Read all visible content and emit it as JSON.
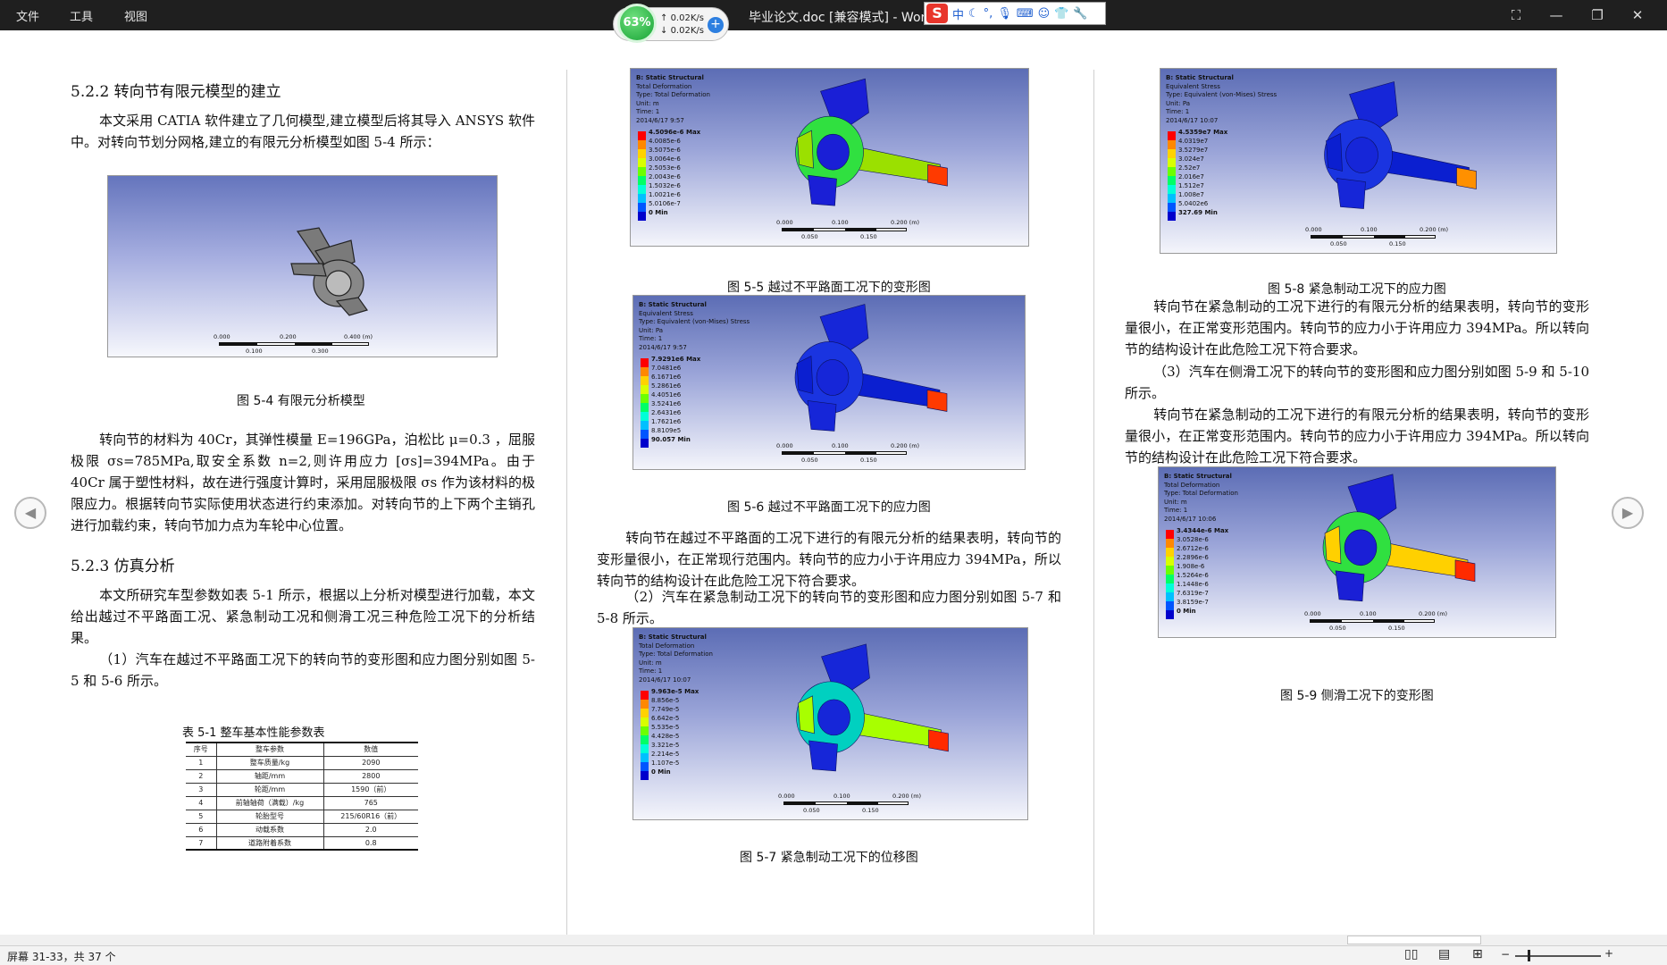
{
  "titlebar": {
    "menu": [
      "文件",
      "工具",
      "视图"
    ],
    "title": "毕业论文.doc [兼容模式] - Word",
    "net_percent": "63%",
    "up_speed": "0.02K/s",
    "down_speed": "0.02K/s",
    "ime_logo": "S",
    "ime_mode": "中"
  },
  "col1": {
    "h_522": "5.2.2 转向节有限元模型的建立",
    "p1": "本文采用 CATIA 软件建立了几何模型,建立模型后将其导入 ANSYS 软件中。对转向节划分网格,建立的有限元分析模型如图 5-4 所示：",
    "fig54_caption": "图 5-4 有限元分析模型",
    "fig54_ticks": [
      "0.000",
      "0.200",
      "0.400 (m)",
      "0.100",
      "0.300"
    ],
    "p2_a": "转向节的材料为 40Cr，其弹性模量 E=196GPa，泊松比 μ=0.3 ，屈服极限 σs=785MPa,取安全系数 n=2,则许用应力 [σs]=394MPa。由于 40Cr 属于塑性材料，故在进行强度计算时，采用屈服极限 σs 作为该材料的极限应力。根据转向节实际使用状态进行约束添加。对转向节的上下两个主销孔进行加载约束，转向节加力点为车轮中心位置。",
    "h_523": "5.2.3 仿真分析",
    "p3": "本文所研究车型参数如表 5-1 所示，根据以上分析对模型进行加载，本文给出越过不平路面工况、紧急制动工况和侧滑工况三种危险工况下的分析结果。",
    "p4": "（1）汽车在越过不平路面工况下的转向节的变形图和应力图分别如图 5-5 和 5-6 所示。",
    "table_title": "表 5-1 整车基本性能参数表",
    "table_headers": [
      "序号",
      "整车参数",
      "数值"
    ],
    "table_rows": [
      [
        "1",
        "整车质量/kg",
        "2090"
      ],
      [
        "2",
        "轴距/mm",
        "2800"
      ],
      [
        "3",
        "轮距/mm",
        "1590（前）"
      ],
      [
        "4",
        "前轴轴荷（满载）/kg",
        "765"
      ],
      [
        "5",
        "轮胎型号",
        "215/60R16（前）"
      ],
      [
        "6",
        "动载系数",
        "2.0"
      ],
      [
        "7",
        "道路附着系数",
        "0.8"
      ]
    ]
  },
  "col2": {
    "fig55": {
      "lines": [
        "B: Static Structural",
        "Total Deformation",
        "Type: Total Deformation",
        "Unit: m",
        "Time: 1",
        "2014/6/17 9:57"
      ],
      "legend": [
        "4.5096e-6 Max",
        "4.0085e-6",
        "3.5075e-6",
        "3.0064e-6",
        "2.5053e-6",
        "2.0043e-6",
        "1.5032e-6",
        "1.0021e-6",
        "5.0106e-7",
        "0 Min"
      ],
      "ticks": [
        "0.000",
        "0.100",
        "0.200 (m)",
        "0.050",
        "0.150"
      ],
      "caption": "图 5-5 越过不平路面工况下的变形图"
    },
    "fig56": {
      "lines": [
        "B: Static Structural",
        "Equivalent Stress",
        "Type: Equivalent (von-Mises) Stress",
        "Unit: Pa",
        "Time: 1",
        "2014/6/17 9:57"
      ],
      "legend": [
        "7.9291e6 Max",
        "7.0481e6",
        "6.1671e6",
        "5.2861e6",
        "4.4051e6",
        "3.5241e6",
        "2.6431e6",
        "1.7621e6",
        "8.8109e5",
        "90.057 Min"
      ],
      "ticks": [
        "0.000",
        "0.100",
        "0.200 (m)",
        "0.050",
        "0.150"
      ],
      "caption": "图 5-6 越过不平路面工况下的应力图"
    },
    "p1": "转向节在越过不平路面的工况下进行的有限元分析的结果表明，转向节的变形量很小，在正常现行范围内。转向节的应力小于许用应力 394MPa，所以转向节的结构设计在此危险工况下符合要求。",
    "p2": "（2）汽车在紧急制动工况下的转向节的变形图和应力图分别如图 5-7 和 5-8 所示。",
    "fig57": {
      "lines": [
        "B: Static Structural",
        "Total Deformation",
        "Type: Total Deformation",
        "Unit: m",
        "Time: 1",
        "2014/6/17 10:07"
      ],
      "legend": [
        "9.963e-5 Max",
        "8.856e-5",
        "7.749e-5",
        "6.642e-5",
        "5.535e-5",
        "4.428e-5",
        "3.321e-5",
        "2.214e-5",
        "1.107e-5",
        "0 Min"
      ],
      "ticks": [
        "0.000",
        "0.100",
        "0.200 (m)",
        "0.050",
        "0.150"
      ],
      "caption": "图 5-7 紧急制动工况下的位移图"
    }
  },
  "col3": {
    "fig58": {
      "lines": [
        "B: Static Structural",
        "Equivalent Stress",
        "Type: Equivalent (von-Mises) Stress",
        "Unit: Pa",
        "Time: 1",
        "2014/6/17 10:07"
      ],
      "legend": [
        "4.5359e7 Max",
        "4.0319e7",
        "3.5279e7",
        "3.024e7",
        "2.52e7",
        "2.016e7",
        "1.512e7",
        "1.008e7",
        "5.0402e6",
        "327.69 Min"
      ],
      "ticks": [
        "0.000",
        "0.100",
        "0.200 (m)",
        "0.050",
        "0.150"
      ],
      "caption": "图 5-8 紧急制动工况下的应力图"
    },
    "p1": "转向节在紧急制动的工况下进行的有限元分析的结果表明，转向节的变形量很小，在正常变形范围内。转向节的应力小于许用应力 394MPa。所以转向节的结构设计在此危险工况下符合要求。",
    "p2": "（3）汽车在侧滑工况下的转向节的变形图和应力图分别如图 5-9 和 5-10 所示。",
    "p3": "转向节在紧急制动的工况下进行的有限元分析的结果表明，转向节的变形量很小，在正常变形范围内。转向节的应力小于许用应力 394MPa。所以转向节的结构设计在此危险工况下符合要求。",
    "fig59": {
      "lines": [
        "B: Static Structural",
        "Total Deformation",
        "Type: Total Deformation",
        "Unit: m",
        "Time: 1",
        "2014/6/17 10:06"
      ],
      "legend": [
        "3.4344e-6 Max",
        "3.0528e-6",
        "2.6712e-6",
        "2.2896e-6",
        "1.908e-6",
        "1.5264e-6",
        "1.1448e-6",
        "7.6319e-7",
        "3.8159e-7",
        "0 Min"
      ],
      "ticks": [
        "0.000",
        "0.100",
        "0.200 (m)",
        "0.050",
        "0.150"
      ],
      "caption": "图 5-9 侧滑工况下的变形图"
    }
  },
  "statusbar": {
    "page_info": "屏幕 31-33，共 37 个"
  },
  "colors": {
    "legend_scale": [
      "#ff0000",
      "#ff8800",
      "#ffd200",
      "#d8ff00",
      "#6cff00",
      "#00ff66",
      "#00ffd8",
      "#00c0ff",
      "#0055ff",
      "#0000cc"
    ]
  }
}
